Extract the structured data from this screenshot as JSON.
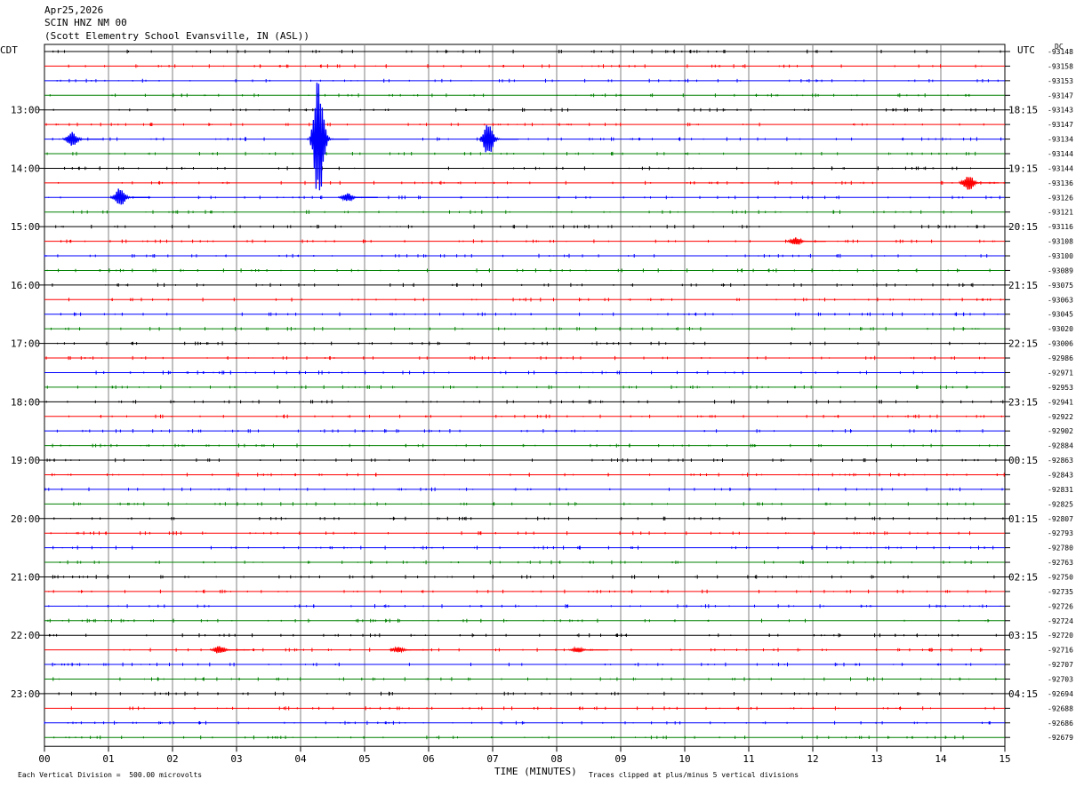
{
  "header": {
    "date": "Apr25,2026",
    "station": "SCIN HNZ NM 00",
    "location": "(Scott Elementry School Evansville, IN (ASL))"
  },
  "axis": {
    "left_label": "CDT",
    "right_label": "UTC",
    "dc_label": "DC",
    "xlabel": "TIME (MINUTES)",
    "footnote_left": "Each Vertical Division =  500.00 microvolts",
    "footnote_right": "Traces clipped at plus/minus 5 vertical divisions"
  },
  "chart_data": {
    "type": "line",
    "title": "SCIN HNZ NM 00",
    "xlabel": "TIME (MINUTES)",
    "ylabel": "",
    "xlim": [
      0,
      15
    ],
    "x_ticks": [
      "00",
      "01",
      "02",
      "03",
      "04",
      "05",
      "06",
      "07",
      "08",
      "09",
      "10",
      "11",
      "12",
      "13",
      "14",
      "15"
    ],
    "trace_colors": [
      "#000000",
      "#ff0000",
      "#0000ff",
      "#008000"
    ],
    "hour_labels_cdt": [
      "13:00",
      "14:00",
      "15:00",
      "16:00",
      "17:00",
      "18:00",
      "19:00",
      "20:00",
      "21:00",
      "22:00",
      "23:00"
    ],
    "hour_labels_utc": [
      "18:15",
      "19:15",
      "20:15",
      "21:15",
      "22:15",
      "23:15",
      "00:15",
      "01:15",
      "02:15",
      "03:15",
      "04:15"
    ],
    "dc_offsets": [
      "-93148",
      "-93158",
      "-93153",
      "-93147",
      "-93143",
      "-93147",
      "-93134",
      "-93144",
      "-93144",
      "-93136",
      "-93126",
      "-93121",
      "-93116",
      "-93108",
      "-93100",
      "-93089",
      "-93075",
      "-93063",
      "-93045",
      "-93020",
      "-93006",
      "-92986",
      "-92971",
      "-92953",
      "-92941",
      "-92922",
      "-92902",
      "-92884",
      "-92863",
      "-92843",
      "-92831",
      "-92825",
      "-92807",
      "-92793",
      "-92780",
      "-92763",
      "-92750",
      "-92735",
      "-92726",
      "-92724",
      "-92720",
      "-92716",
      "-92707",
      "-92703",
      "-92694",
      "-92688",
      "-92686",
      "-92679"
    ],
    "events": [
      {
        "trace": 6,
        "minute": 4.45,
        "amp": 4.5,
        "label": "largest spike"
      },
      {
        "trace": 6,
        "minute": 0.6,
        "amp": 0.5
      },
      {
        "trace": 6,
        "minute": 7.1,
        "amp": 1.2
      },
      {
        "trace": 9,
        "minute": 14.6,
        "amp": 0.6
      },
      {
        "trace": 10,
        "minute": 1.35,
        "amp": 0.7
      },
      {
        "trace": 10,
        "minute": 4.9,
        "amp": 0.3
      },
      {
        "trace": 13,
        "minute": 11.9,
        "amp": 0.3
      },
      {
        "trace": 41,
        "minute": 2.9,
        "amp": 0.3
      },
      {
        "trace": 41,
        "minute": 5.7,
        "amp": 0.2
      },
      {
        "trace": 41,
        "minute": 8.5,
        "amp": 0.2
      }
    ]
  }
}
